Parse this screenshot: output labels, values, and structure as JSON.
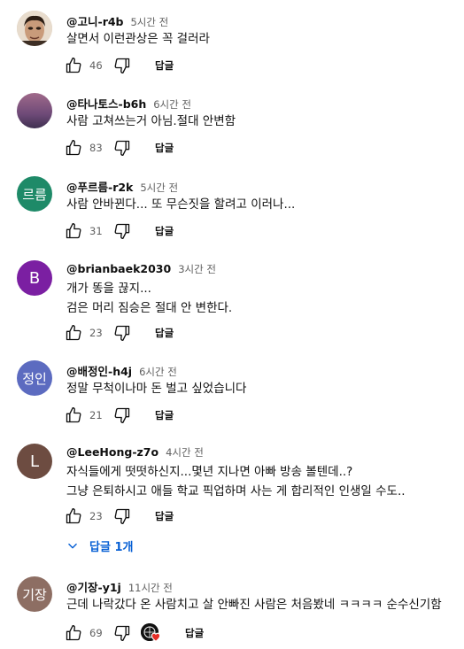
{
  "reply_label": "답글",
  "colors": {
    "link_blue": "#065fd4",
    "muted": "#606060"
  },
  "comments": [
    {
      "handle": "@고니-r4b",
      "time": "5시간 전",
      "lines": [
        "살면서 이런관상은 꼭 걸러라"
      ],
      "likes": "46",
      "avatar": {
        "type": "photo",
        "text": "",
        "color": "#5a4638"
      }
    },
    {
      "handle": "@타나토스-b6h",
      "time": "6시간 전",
      "lines": [
        "사람 고쳐쓰는거 아님.절대 안변함"
      ],
      "likes": "83",
      "avatar": {
        "type": "gradient",
        "text": "",
        "color": "#8c5a7a"
      }
    },
    {
      "handle": "@푸르름-r2k",
      "time": "5시간 전",
      "lines": [
        "사람 안바뀐다... 또 무슨짓을 할려고 이러나..."
      ],
      "likes": "31",
      "avatar": {
        "type": "text",
        "text": "르름",
        "color": "#1e8a68"
      }
    },
    {
      "handle": "@brianbaek2030",
      "time": "3시간 전",
      "lines": [
        "개가 똥을 끊지...",
        "검은 머리 짐승은 절대 안 변한다."
      ],
      "likes": "23",
      "avatar": {
        "type": "text",
        "text": "B",
        "color": "#7b1fa2"
      }
    },
    {
      "handle": "@배정인-h4j",
      "time": "6시간 전",
      "lines": [
        "정말 무척이나마 돈 벌고 싶었습니다"
      ],
      "likes": "21",
      "avatar": {
        "type": "text",
        "text": "정인",
        "color": "#5c6bc0"
      }
    },
    {
      "handle": "@LeeHong-z7o",
      "time": "4시간 전",
      "lines": [
        "자식들에게 떳떳하신지...몇년 지나면 아빠 방송 볼텐데..?",
        "그냥 은퇴하시고 애들 학교 픽업하며 사는 게 합리적인 인생일 수도.."
      ],
      "likes": "23",
      "avatar": {
        "type": "text",
        "text": "L",
        "color": "#6d4c41"
      },
      "replies_label": "답글 1개"
    },
    {
      "handle": "@기장-y1j",
      "time": "11시간 전",
      "lines": [
        "근데 나락갔다 온 사람치고 살 안빠진 사람은 처음봤네 ㅋㅋㅋㅋ 순수신기함"
      ],
      "likes": "69",
      "avatar": {
        "type": "text",
        "text": "기장",
        "color": "#8d6e63"
      },
      "creator_heart": true
    }
  ]
}
